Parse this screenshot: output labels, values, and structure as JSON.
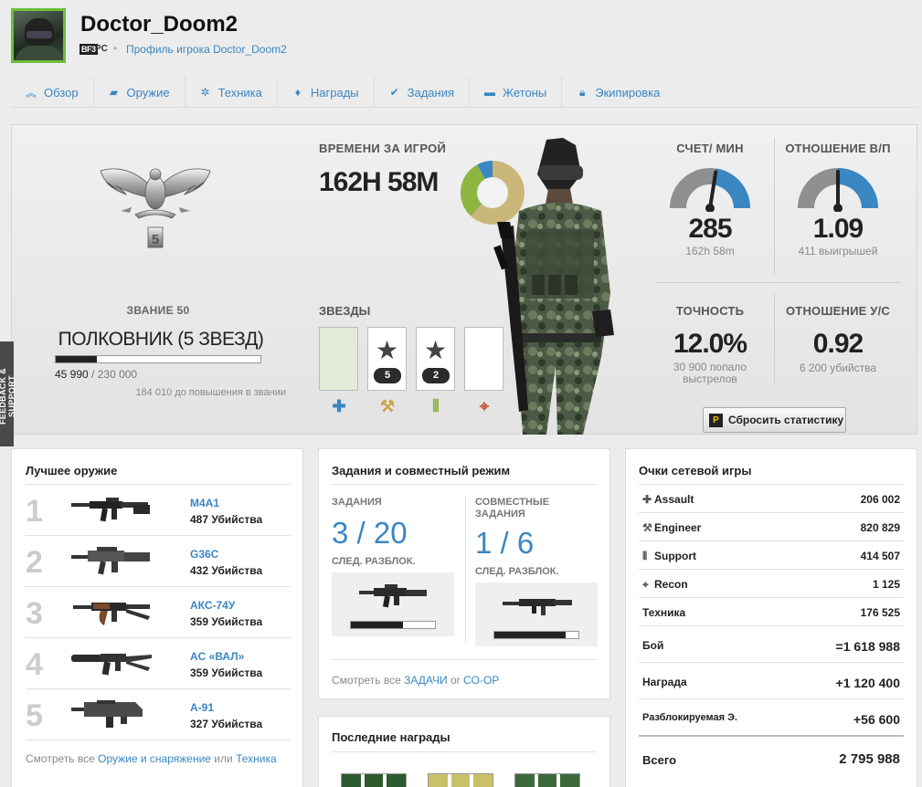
{
  "player": {
    "name": "Doctor_Doom2",
    "game_badge": "BF3",
    "platform": "PC",
    "profile_link": "Профиль игрока Doctor_Doom2"
  },
  "nav": [
    {
      "label": "Обзор",
      "icon": "chevron-up-icon"
    },
    {
      "label": "Оружие",
      "icon": "gun-icon"
    },
    {
      "label": "Техника",
      "icon": "gear-icon"
    },
    {
      "label": "Награды",
      "icon": "medal-icon"
    },
    {
      "label": "Задания",
      "icon": "check-icon"
    },
    {
      "label": "Жетоны",
      "icon": "dogtag-icon"
    },
    {
      "label": "Экипировка",
      "icon": "lock-icon"
    }
  ],
  "rank": {
    "label": "ЗВАНИЕ 50",
    "insignia_number": "5",
    "name": "ПОЛКОВНИК (5 ЗВЕЗД)",
    "xp_current": "45 990",
    "xp_total": "/ 230 000",
    "progress": 0.2,
    "to_next": "184 010 до повышения в звании"
  },
  "time": {
    "label": "ВРЕМЕНИ ЗА ИГРОЙ",
    "value": "162H 58M",
    "breakdown": [
      {
        "fraction": 0.62,
        "color": "#c9b77a"
      },
      {
        "fraction": 0.3,
        "color": "#8db542"
      },
      {
        "fraction": 0.08,
        "color": "#3a87c2"
      }
    ]
  },
  "stars": {
    "label": "ЗВЕЗДЫ",
    "slots": [
      {
        "count": "",
        "kit_icon": "assault-plus-icon",
        "color": "#3a87c2"
      },
      {
        "count": "5",
        "kit_icon": "wrench-icon",
        "color": "#c9a44a"
      },
      {
        "count": "2",
        "kit_icon": "ammo-icon",
        "color": "#8db542"
      },
      {
        "count": "",
        "kit_icon": "crosshair-icon",
        "color": "#c0603a"
      }
    ]
  },
  "stats": {
    "spm": {
      "label": "СЧЕТ/ МИН",
      "value": "285",
      "sub": "162h 58m",
      "level": 0.55
    },
    "wl": {
      "label": "ОТНОШЕНИЕ В/П",
      "value": "1.09",
      "sub": "411 выигрышей",
      "level": 0.5
    },
    "accuracy": {
      "label": "ТОЧНОСТЬ",
      "value": "12.0%",
      "sub": "30 900 попало выстрелов"
    },
    "kd": {
      "label": "ОТНОШЕНИЕ У/С",
      "value": "0.92",
      "sub": "6 200 убийства"
    }
  },
  "reset_button": "Сбросить статистику",
  "feedback": "FEEDBACK & SUPPORT",
  "best_weapons": {
    "title": "Лучшее оружие",
    "items": [
      {
        "rank": "1",
        "name": "M4A1",
        "kills": "487 Убийства"
      },
      {
        "rank": "2",
        "name": "G36C",
        "kills": "432 Убийства"
      },
      {
        "rank": "3",
        "name": "АКС-74У",
        "kills": "359 Убийства"
      },
      {
        "rank": "4",
        "name": "AC «ВАЛ»",
        "kills": "359 Убийства"
      },
      {
        "rank": "5",
        "name": "A-91",
        "kills": "327 Убийства"
      }
    ],
    "more_prefix": "Смотреть все",
    "more_link1": "Оружие и снаряжение",
    "more_or": "или",
    "more_link2": "Техника"
  },
  "assignments": {
    "title": "Задания и совместный режим",
    "tasks_label": "ЗАДАНИЯ",
    "tasks_value": "3 / 20",
    "tasks_progress": 0.62,
    "coop_label": "СОВМЕСТНЫЕ ЗАДАНИЯ",
    "coop_value": "1 / 6",
    "coop_progress": 0.85,
    "next_unlock": "СЛЕД. РАЗБЛОК.",
    "more_prefix": "Смотреть все",
    "more_link1": "ЗАДАЧИ",
    "more_or": "or",
    "more_link2": "CO-OP"
  },
  "recent_awards": {
    "title": "Последние награды",
    "ribbons": [
      {
        "color": "#2d5a2d"
      },
      {
        "color": "#c9c06a"
      },
      {
        "color": "#3a6a3a"
      }
    ]
  },
  "online_points": {
    "title": "Очки сетевой игры",
    "rows": [
      {
        "label": "Assault",
        "value": "206 002",
        "icon": "assault-plus-icon",
        "glyph": "✚"
      },
      {
        "label": "Engineer",
        "value": "820 829",
        "icon": "wrench-icon",
        "glyph": "⚒"
      },
      {
        "label": "Support",
        "value": "414 507",
        "icon": "ammo-icon",
        "glyph": "⦀"
      },
      {
        "label": "Recon",
        "value": "1 125",
        "icon": "crosshair-icon",
        "glyph": "⌖"
      },
      {
        "label": "Техника",
        "value": "176 525",
        "icon": "",
        "glyph": ""
      }
    ],
    "combat_label": "Бой",
    "combat_value": "=1 618 988",
    "award_label": "Награда",
    "award_value": "+1 120 400",
    "unlock_label": "Разблокируемая Э.",
    "unlock_value": "+56 600",
    "total_label": "Всего",
    "total_value": "2 795 988"
  }
}
